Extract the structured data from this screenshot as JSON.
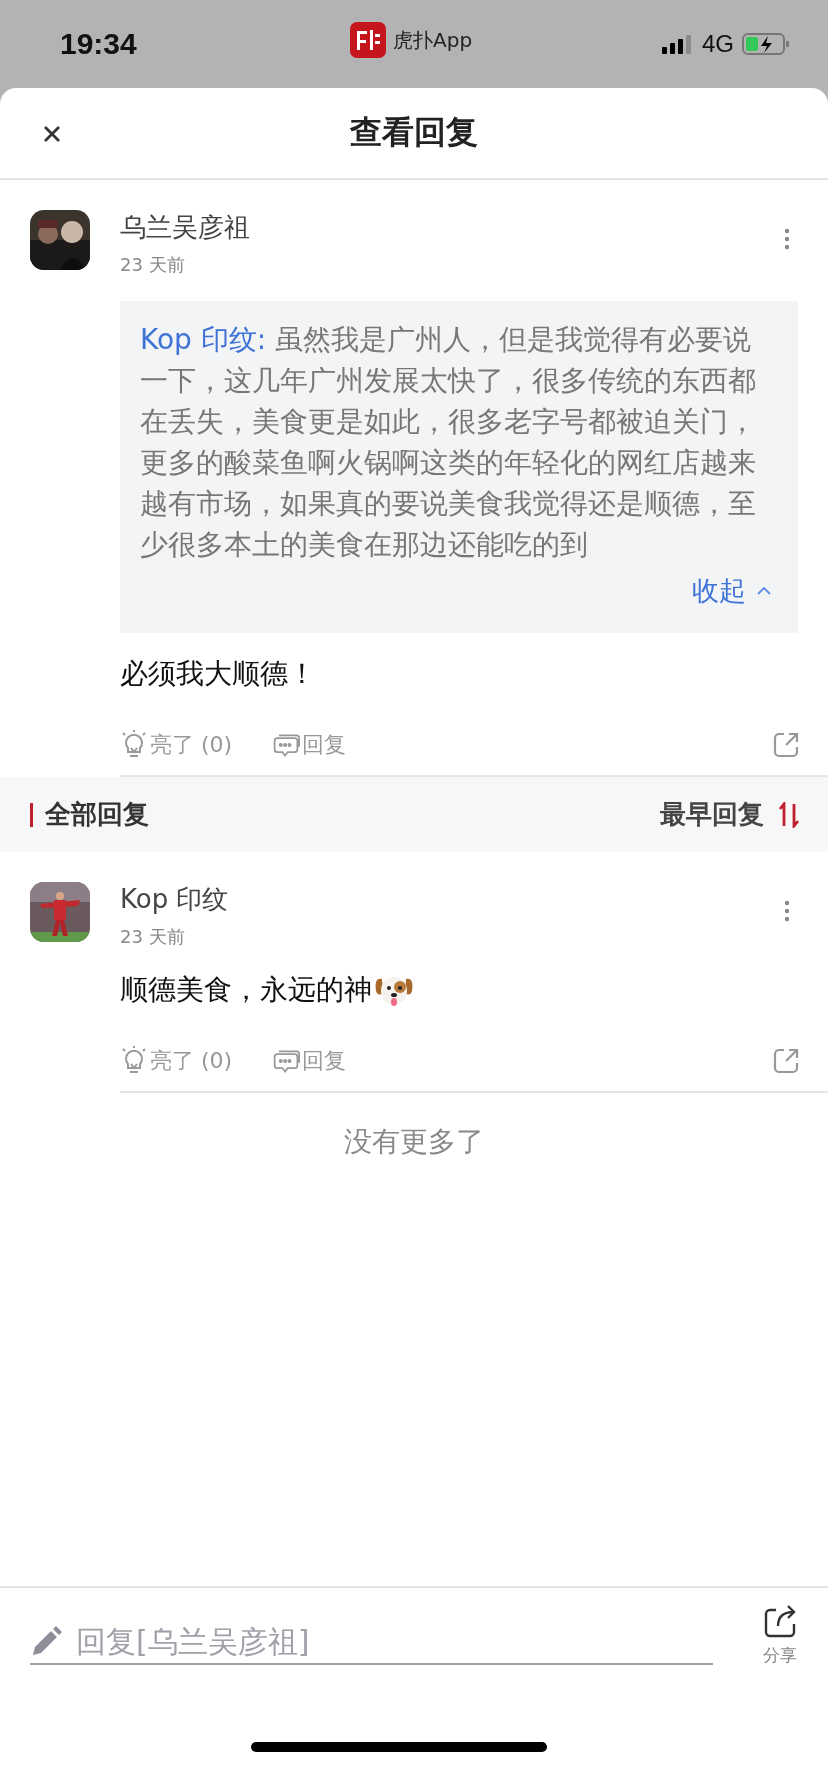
{
  "status_bar": {
    "time": "19:34",
    "app_name": "虎扑App",
    "network": "4G"
  },
  "header": {
    "title": "查看回复"
  },
  "main_comment": {
    "author": "乌兰吴彦祖",
    "time": "23 天前",
    "quote": {
      "author": "Kop 印纹:",
      "text": "虽然我是广州人，但是我觉得有必要说一下，这几年广州发展太快了，很多传统的东西都在丢失，美食更是如此，很多老字号都被迫关门，更多的酸菜鱼啊火锅啊这类的年轻化的网红店越来越有市场，如果真的要说美食我觉得还是顺德，至少很多本土的美食在那边还能吃的到",
      "collapse_label": "收起"
    },
    "body": "必须我大顺德！",
    "like_label": "亮了 (0)",
    "reply_label": "回复"
  },
  "section": {
    "title": "全部回复",
    "sort_label": "最早回复"
  },
  "replies": [
    {
      "author": "Kop 印纹",
      "time": "23 天前",
      "body": "顺德美食，永远的神",
      "dog_emoji": true,
      "like_label": "亮了 (0)",
      "reply_label": "回复"
    }
  ],
  "end_text": "没有更多了",
  "bottom_bar": {
    "placeholder": "回复[乌兰吴彦祖]",
    "share_label": "分享"
  }
}
